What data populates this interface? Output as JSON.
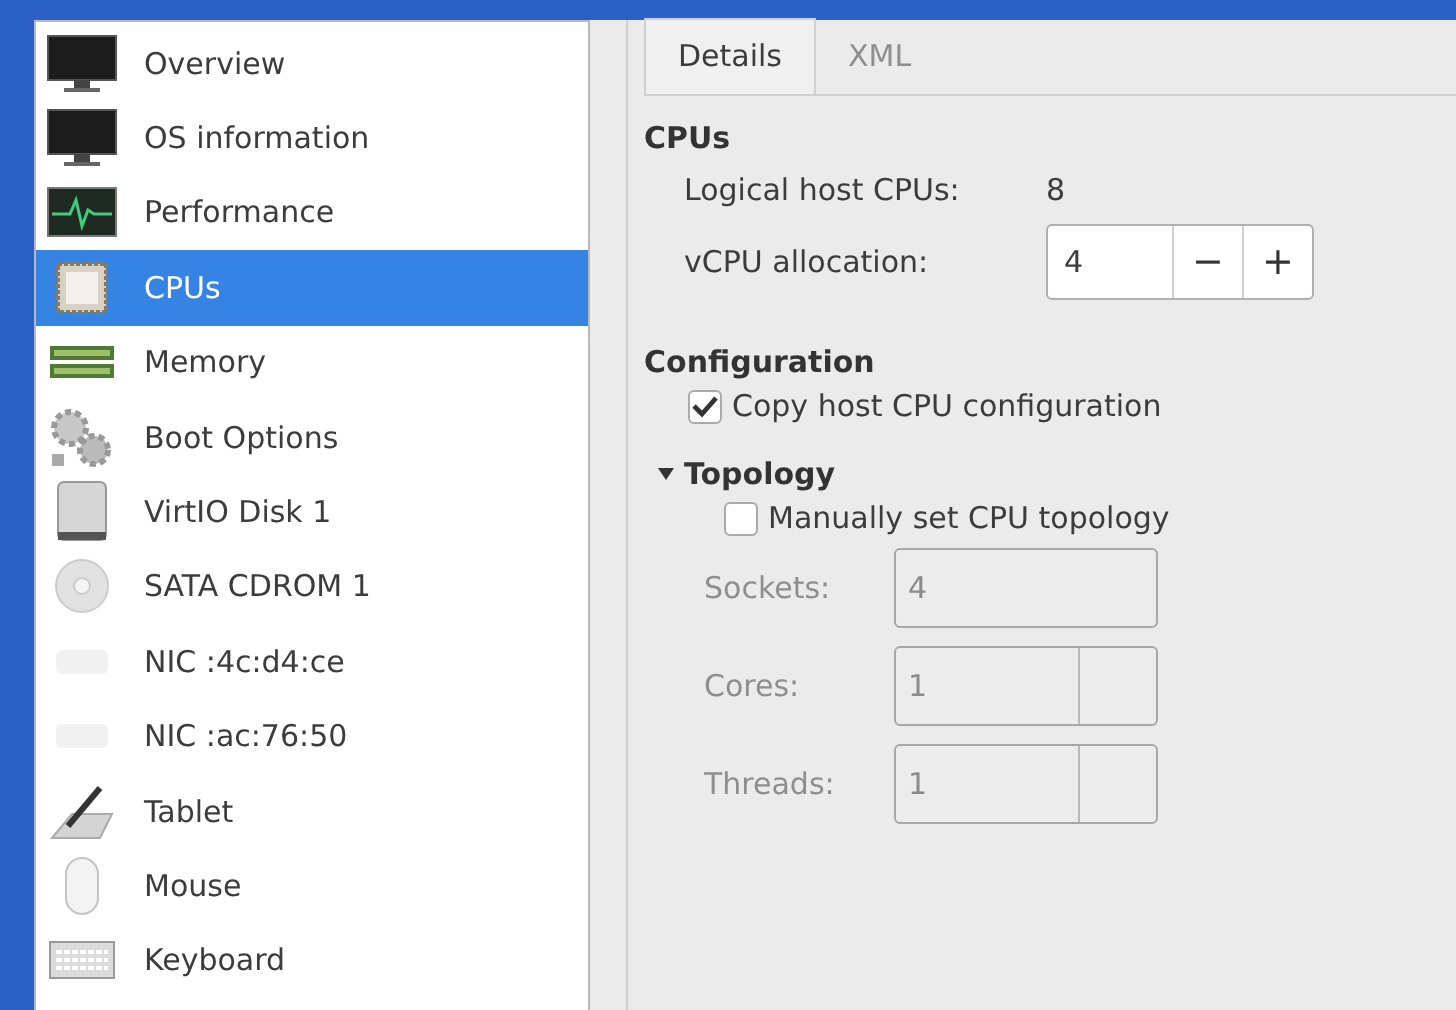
{
  "sidebar": {
    "items": [
      {
        "label": "Overview",
        "kind": "monitor",
        "selected": false
      },
      {
        "label": "OS information",
        "kind": "monitor",
        "selected": false
      },
      {
        "label": "Performance",
        "kind": "performance",
        "selected": false
      },
      {
        "label": "CPUs",
        "kind": "chip",
        "selected": true
      },
      {
        "label": "Memory",
        "kind": "memory",
        "selected": false
      },
      {
        "label": "Boot Options",
        "kind": "gears",
        "selected": false
      },
      {
        "label": "VirtIO Disk 1",
        "kind": "disk",
        "selected": false
      },
      {
        "label": "SATA CDROM 1",
        "kind": "cdrom",
        "selected": false
      },
      {
        "label": "NIC :4c:d4:ce",
        "kind": "nic",
        "selected": false
      },
      {
        "label": "NIC :ac:76:50",
        "kind": "nic",
        "selected": false
      },
      {
        "label": "Tablet",
        "kind": "tablet",
        "selected": false
      },
      {
        "label": "Mouse",
        "kind": "mouse",
        "selected": false
      },
      {
        "label": "Keyboard",
        "kind": "keyboard",
        "selected": false
      }
    ]
  },
  "tabs": [
    {
      "label": "Details",
      "selected": true,
      "disabled": false
    },
    {
      "label": "XML",
      "selected": false,
      "disabled": true
    }
  ],
  "cpus": {
    "title": "CPUs",
    "logical_host_cpus": {
      "label": "Logical host CPUs:",
      "value": "8"
    },
    "vcpu_allocation": {
      "label": "vCPU allocation:",
      "value": "4",
      "decrement": "−",
      "increment": "+"
    }
  },
  "configuration": {
    "title": "Configuration",
    "copy_host": {
      "label": "Copy host CPU configuration",
      "checked": true
    }
  },
  "topology": {
    "title": "Topology",
    "expanded": true,
    "manual": {
      "label": "Manually set CPU topology",
      "checked": false
    },
    "fields": [
      {
        "label": "Sockets:",
        "value": "4",
        "kind": "entry",
        "disabled": true
      },
      {
        "label": "Cores:",
        "value": "1",
        "kind": "spin",
        "disabled": true
      },
      {
        "label": "Threads:",
        "value": "1",
        "kind": "spin",
        "disabled": true
      }
    ]
  }
}
